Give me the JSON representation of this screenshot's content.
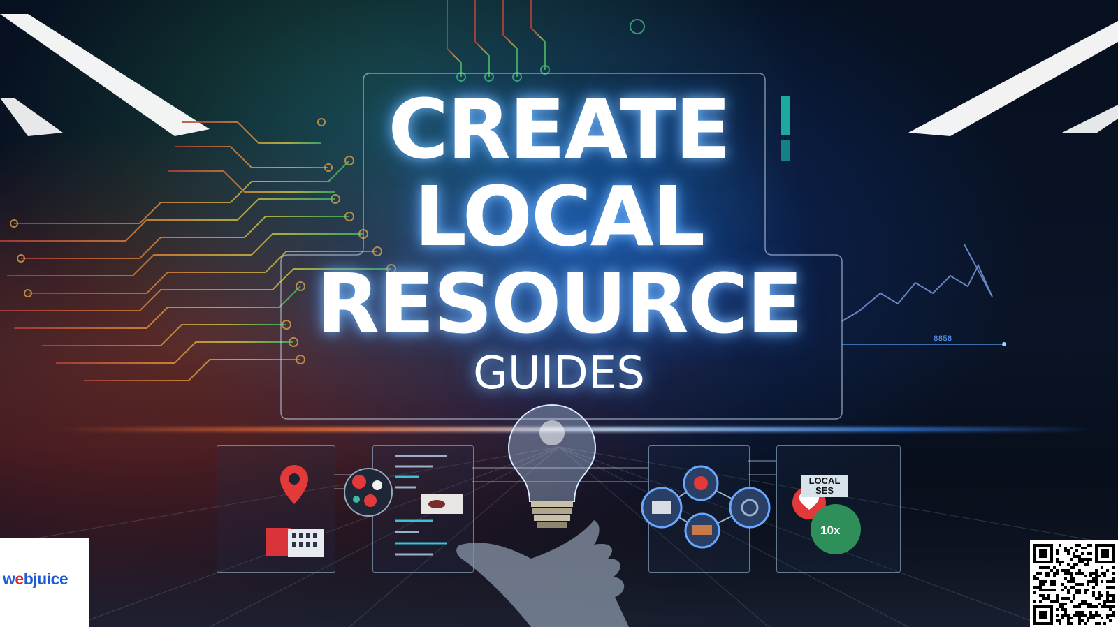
{
  "title": {
    "line1": "CREATE",
    "line2": "LOCAL",
    "line3": "RESOURCE",
    "line4": "GUIDES"
  },
  "brand": {
    "logo_prefix": "w",
    "logo_e": "e",
    "logo_suffix": "bjuice"
  },
  "panels": {
    "local_label": "LOCAL",
    "local_label_sub": "SES",
    "badge_text": "10x",
    "chart_label": "8858"
  },
  "colors": {
    "accent_blue": "#3f8cff",
    "accent_orange": "#ff7a3c",
    "pin_red": "#e23a3a",
    "badge_green": "#2f8f5a",
    "logo_blue": "#1d5bd8",
    "logo_red": "#e02a2a"
  },
  "icons": [
    "map-pin-icon",
    "building-icon",
    "lightbulb-icon",
    "hand-icon",
    "heart-icon",
    "qr-code-icon"
  ]
}
